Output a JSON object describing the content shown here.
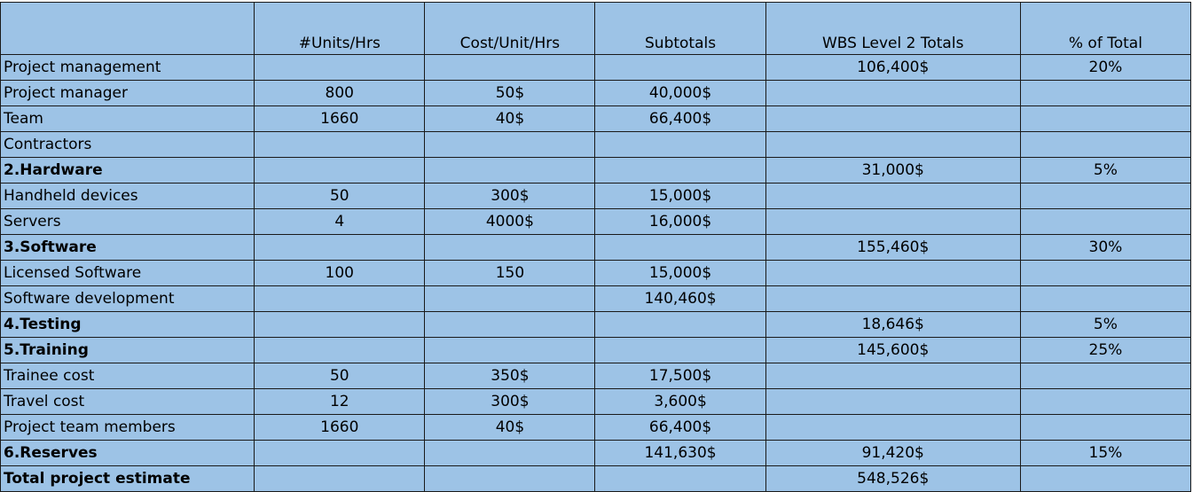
{
  "headers": {
    "label": "",
    "units": "#Units/Hrs",
    "cost": "Cost/Unit/Hrs",
    "subtotals": "Subtotals",
    "wbs": "WBS Level 2 Totals",
    "pct": "% of Total"
  },
  "rows": [
    {
      "label": "Project management",
      "units": "",
      "cost": "",
      "subtotal": "",
      "wbs": "106,400$",
      "pct": "20%",
      "bold": false
    },
    {
      "label": "Project manager",
      "units": "800",
      "cost": "50$",
      "subtotal": "40,000$",
      "wbs": "",
      "pct": "",
      "bold": false
    },
    {
      "label": "Team",
      "units": "1660",
      "cost": "40$",
      "subtotal": "66,400$",
      "wbs": "",
      "pct": "",
      "bold": false
    },
    {
      "label": "Contractors",
      "units": "",
      "cost": "",
      "subtotal": "",
      "wbs": "",
      "pct": "",
      "bold": false
    },
    {
      "label": "2.Hardware",
      "units": "",
      "cost": "",
      "subtotal": "",
      "wbs": "31,000$",
      "pct": "5%",
      "bold": true
    },
    {
      "label": "Handheld devices",
      "units": "50",
      "cost": "300$",
      "subtotal": "15,000$",
      "wbs": "",
      "pct": "",
      "bold": false
    },
    {
      "label": "Servers",
      "units": "4",
      "cost": "4000$",
      "subtotal": "16,000$",
      "wbs": "",
      "pct": "",
      "bold": false
    },
    {
      "label": "3.Software",
      "units": "",
      "cost": "",
      "subtotal": "",
      "wbs": "155,460$",
      "pct": "30%",
      "bold": true
    },
    {
      "label": "Licensed Software",
      "units": "100",
      "cost": "150",
      "subtotal": "15,000$",
      "wbs": "",
      "pct": "",
      "bold": false
    },
    {
      "label": "Software development",
      "units": "",
      "cost": "",
      "subtotal": "140,460$",
      "wbs": "",
      "pct": "",
      "bold": false
    },
    {
      "label": "4.Testing",
      "units": "",
      "cost": "",
      "subtotal": "",
      "wbs": "18,646$",
      "pct": "5%",
      "bold": true
    },
    {
      "label": "5.Training",
      "units": "",
      "cost": "",
      "subtotal": "",
      "wbs": "145,600$",
      "pct": "25%",
      "bold": true
    },
    {
      "label": "Trainee cost",
      "units": "50",
      "cost": "350$",
      "subtotal": "17,500$",
      "wbs": "",
      "pct": "",
      "bold": false
    },
    {
      "label": "Travel cost",
      "units": "12",
      "cost": "300$",
      "subtotal": "3,600$",
      "wbs": "",
      "pct": "",
      "bold": false
    },
    {
      "label": "Project team members",
      "units": "1660",
      "cost": "40$",
      "subtotal": "66,400$",
      "wbs": "",
      "pct": "",
      "bold": false
    },
    {
      "label": "6.Reserves",
      "units": "",
      "cost": "",
      "subtotal": "141,630$",
      "wbs": "91,420$",
      "pct": "15%",
      "bold": true
    },
    {
      "label": "Total project estimate",
      "units": "",
      "cost": "",
      "subtotal": "",
      "wbs": "548,526$",
      "pct": "",
      "bold": true
    }
  ]
}
